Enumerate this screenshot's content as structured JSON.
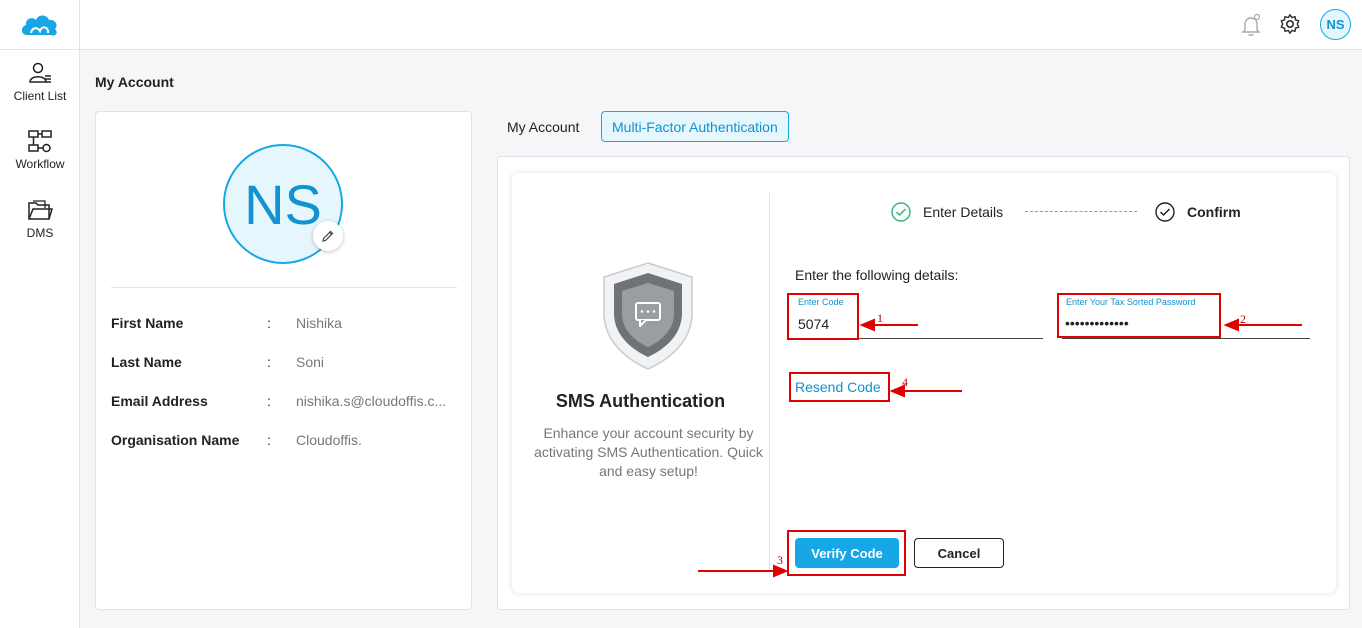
{
  "header": {
    "logo_icon": "cloud-logo-icon",
    "notification_icon": "bell-icon",
    "settings_icon": "gear-icon",
    "user_initials": "NS"
  },
  "sidebar": {
    "items": [
      {
        "label": "Client List",
        "icon": "user-list-icon"
      },
      {
        "label": "Workflow",
        "icon": "workflow-icon"
      },
      {
        "label": "DMS",
        "icon": "folder-icon"
      }
    ]
  },
  "page": {
    "title": "My Account"
  },
  "profile": {
    "initials": "NS",
    "edit_icon": "pencil-icon",
    "fields": [
      {
        "label": "First Name",
        "separator": ":",
        "value": "Nishika"
      },
      {
        "label": "Last Name",
        "separator": ":",
        "value": "Soni"
      },
      {
        "label": "Email Address",
        "separator": ":",
        "value": "nishika.s@cloudoffis.c..."
      },
      {
        "label": "Organisation Name",
        "separator": ":",
        "value": "Cloudoffis."
      }
    ]
  },
  "tabs": [
    {
      "label": "My Account",
      "active": false
    },
    {
      "label": "Multi-Factor Authentication",
      "active": true
    }
  ],
  "mfa": {
    "shield_icon": "shield-chat-icon",
    "title": "SMS Authentication",
    "description": "Enhance your account security by activating SMS Authentication. Quick and easy setup!",
    "steps": [
      {
        "label": "Enter Details",
        "state": "done",
        "icon": "check-circle-icon"
      },
      {
        "label": "Confirm",
        "state": "current",
        "icon": "check-circle-icon"
      }
    ],
    "form_heading": "Enter the following details:",
    "code_field": {
      "label": "Enter Code",
      "value": "5074"
    },
    "password_field": {
      "label": "Enter Your Tax Sorted Password",
      "value": "•••••••••••••"
    },
    "resend_label": "Resend Code",
    "verify_label": "Verify Code",
    "cancel_label": "Cancel"
  },
  "annotations": {
    "numbers": [
      "1",
      "2",
      "3",
      "4"
    ],
    "color": "#e00000"
  },
  "colors": {
    "accent": "#17a7e6",
    "accent_text": "#1292cf",
    "success": "#2eb872"
  }
}
